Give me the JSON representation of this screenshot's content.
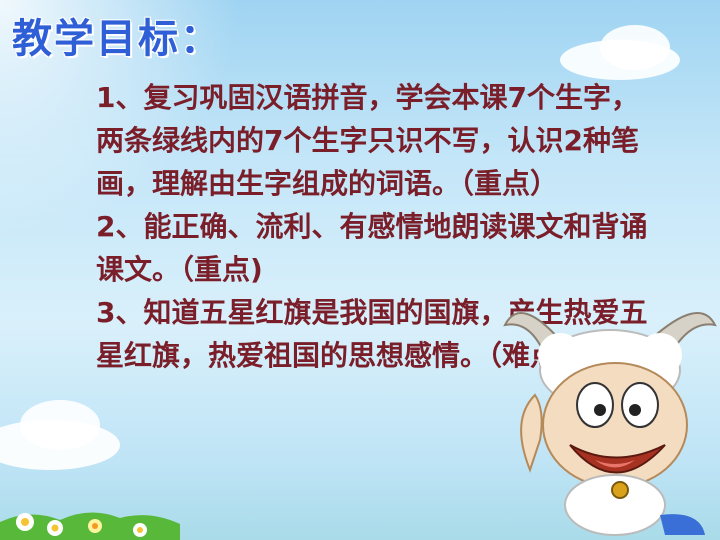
{
  "title": "教学目标：",
  "objectives": [
    "1、复习巩固汉语拼音，学会本课7个生字，两条绿线内的7个生字只识不写，认识2种笔画，理解由生字组成的词语。（重点）",
    "2、能正确、流利、有感情地朗读课文和背诵课文。（重点)",
    "3、知道五星红旗是我国的国旗，产生热爱五星红旗，热爱祖国的思想感情。（难点）"
  ],
  "colors": {
    "title": "#2f5fd6",
    "body_text": "#7a1f2a",
    "sky": "#c4e6f8"
  }
}
